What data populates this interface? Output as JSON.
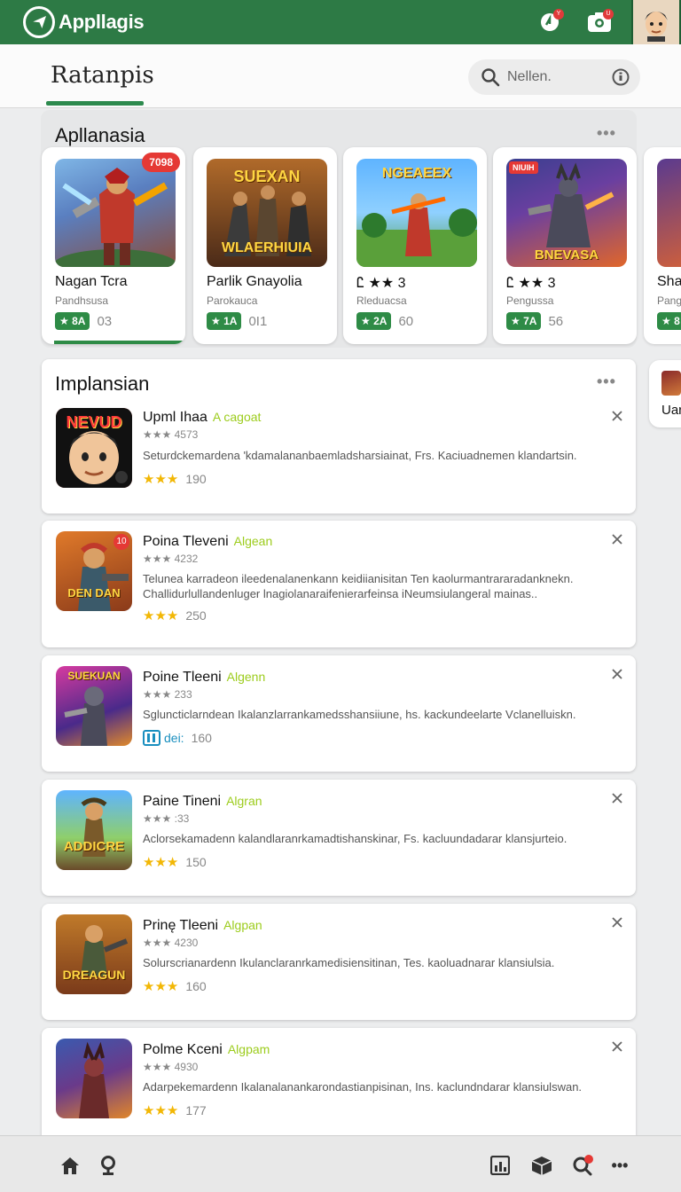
{
  "appbar": {
    "brand": "Appllagis",
    "accent": "#2d7a45",
    "icons": [
      "refresh-icon",
      "camera-icon",
      "avatar"
    ]
  },
  "header": {
    "title": "Ratanpis",
    "search_placeholder": "Nellen."
  },
  "featured": {
    "title": "Apllanasia",
    "cards": [
      {
        "thumb_text": "",
        "badge": "7098",
        "name": "Nagan Tcra",
        "sub": "Pandhsusa",
        "rating": "★ 8A",
        "count": "03"
      },
      {
        "thumb_text": "WLAERHIUIA",
        "thumb_top": "SUEXAN",
        "badge": "",
        "name": "Parlik Gnayolia",
        "sub": "Parokauca",
        "rating": "★ 1A",
        "count": "0I1"
      },
      {
        "thumb_text": "",
        "thumb_top": "NGEAEEX",
        "badge": "",
        "name": "Ꮭ ★★ 3",
        "sub": "Rleduacsa",
        "rating": "★ 2A",
        "count": "60"
      },
      {
        "thumb_text": "BNEVASA",
        "thumb_top": "",
        "badge": "NIUIH",
        "name": "Ꮭ ★★ 3",
        "sub": "Pengussa",
        "rating": "★ 7A",
        "count": "56"
      },
      {
        "thumb_text": "",
        "thumb_top": "",
        "badge": "",
        "name": "Sha",
        "sub": "Pang",
        "rating": "★ 8",
        "count": ""
      }
    ],
    "peek_label": "Uar"
  },
  "list": {
    "title": "Implansian",
    "items": [
      {
        "name": "Upml Ihaa",
        "tag": "A cagoat",
        "meta": "★★★ 4573",
        "desc": "Seturdckemardena 'kdamalananbaemladsharsiainat, Frs. Kaciuadnemen klandartsin.",
        "stars": "★★★",
        "count": "190",
        "icon_text": "NEVUD"
      },
      {
        "name": "Poina Tleveni",
        "tag": "Algean",
        "meta": "★★★ 4232",
        "desc": "Telunea karradeon ileedenalanenkann keidiianisitan Ten kaolurmantrararadanknekn. Challidurlullandenluger lnagiolanaraifenierarfeinsa iNeumsiulangeral mainas..",
        "stars": "★★★",
        "count": "250",
        "icon_text": "DEN DAN",
        "icon_badge": "10"
      },
      {
        "name": "Poine Tleeni",
        "tag": "Algenn",
        "meta": "★★★ 233",
        "desc": "Sgluncticlarndean Ikalanzlarrankamedsshansiiune, hs. kackundeelarte Vclanelluiskn.",
        "stars": "",
        "count": "160",
        "icon_text": "SUEKUAN",
        "foot_alt": "dei:"
      },
      {
        "name": "Paine Tineni",
        "tag": "Algran",
        "meta": "★★★ :33",
        "desc": "Aclorsekamadenn kalandlaranrkamadtishanskinar, Fs. kacluundadarar klansjurteio.",
        "stars": "★★★",
        "count": "150",
        "icon_text": "ADDICRE"
      },
      {
        "name": "Prinę Tleeni",
        "tag": "Algpan",
        "meta": "★★★ 4230",
        "desc": "Solurscrianardenn Ikulanclaranrkamedisiensitinan, Tes. kaoluadnarar klansiulsia.",
        "stars": "★★★",
        "count": "160",
        "icon_text": "DREAGUN"
      },
      {
        "name": "Polme Kceni",
        "tag": "Algpam",
        "meta": "★★★ 4930",
        "desc": "Adarpekemardenn Ikalanalanankarondastianpisinan, Ins. kaclundndarar klansiulswan.",
        "stars": "★★★",
        "count": "177",
        "icon_text": ""
      }
    ]
  },
  "bottom_nav": {
    "items": [
      "home-icon",
      "location-icon",
      "chart-icon",
      "box-icon",
      "search-icon",
      "more-icon"
    ]
  }
}
